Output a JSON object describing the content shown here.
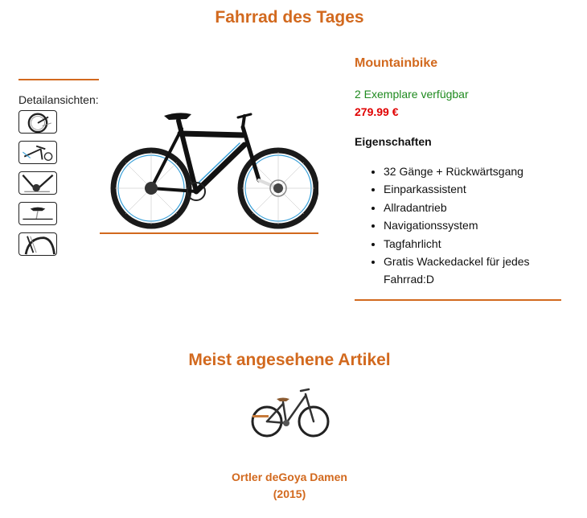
{
  "section_daily": {
    "title": "Fahrrad des Tages"
  },
  "gallery": {
    "label": "Detailansichten:",
    "thumbnails": [
      "wheel-detail",
      "handlebar-detail",
      "frame-detail",
      "saddle-detail",
      "fork-detail"
    ]
  },
  "product": {
    "name": "Mountainbike",
    "availability": "2 Exemplare verfügbar",
    "price": "279.99 €",
    "properties_heading": "Eigenschaften",
    "properties": [
      "32 Gänge + Rückwärtsgang",
      "Einparkassistent",
      "Allradantrieb",
      "Navigationssystem",
      "Tagfahrlicht",
      "Gratis Wackedackel für jedes Fahrrad:D"
    ]
  },
  "section_popular": {
    "title": "Meist angesehene Artikel",
    "items": [
      {
        "name_line1": "Ortler deGoya Damen",
        "name_line2": "(2015)"
      }
    ]
  },
  "colors": {
    "accent": "#d2691e",
    "available": "#1f8a1f",
    "price": "#e00000"
  }
}
